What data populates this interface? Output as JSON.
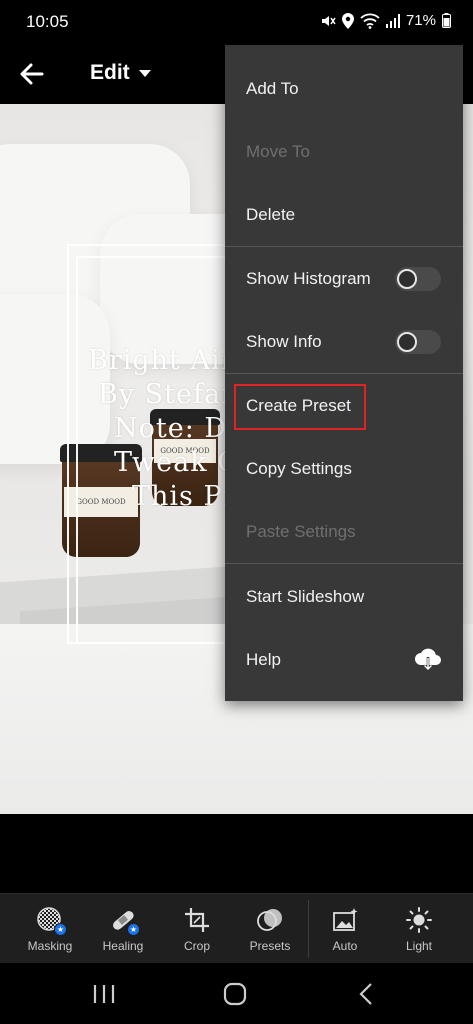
{
  "status_bar": {
    "time": "10:05",
    "battery": "71%",
    "icons": [
      "mute-icon",
      "location-icon",
      "wifi-icon",
      "signal-icon",
      "battery-icon"
    ]
  },
  "header": {
    "title": "Edit",
    "icons": [
      "back-arrow-icon",
      "dropdown-caret-icon"
    ]
  },
  "photo": {
    "overlay_lines": [
      "Bright Airy P",
      "By Stefania G",
      "Note: Do N",
      "Tweak Or S",
      "This Prese"
    ],
    "jar_label": "GOOD MOOD"
  },
  "menu": {
    "items": [
      {
        "label": "Add To",
        "enabled": true
      },
      {
        "label": "Move To",
        "enabled": false
      },
      {
        "label": "Delete",
        "enabled": true
      },
      {
        "label": "Show Histogram",
        "enabled": true,
        "toggle": false
      },
      {
        "label": "Show Info",
        "enabled": true,
        "toggle": false
      },
      {
        "label": "Create Preset",
        "enabled": true,
        "highlighted": true
      },
      {
        "label": "Copy Settings",
        "enabled": true
      },
      {
        "label": "Paste Settings",
        "enabled": false
      },
      {
        "label": "Start Slideshow",
        "enabled": true
      },
      {
        "label": "Help",
        "enabled": true,
        "icon": "cloud-download-icon"
      }
    ],
    "highlight_color": "#e02424"
  },
  "toolbar": {
    "tools": [
      {
        "label": "Masking",
        "icon": "masking-icon",
        "premium": true
      },
      {
        "label": "Healing",
        "icon": "healing-icon",
        "premium": true
      },
      {
        "label": "Crop",
        "icon": "crop-icon"
      },
      {
        "label": "Presets",
        "icon": "presets-icon"
      },
      {
        "label": "Auto",
        "icon": "auto-icon"
      },
      {
        "label": "Light",
        "icon": "light-icon"
      }
    ]
  },
  "navbar": {
    "buttons": [
      "recent-apps-icon",
      "home-icon",
      "back-icon"
    ]
  }
}
